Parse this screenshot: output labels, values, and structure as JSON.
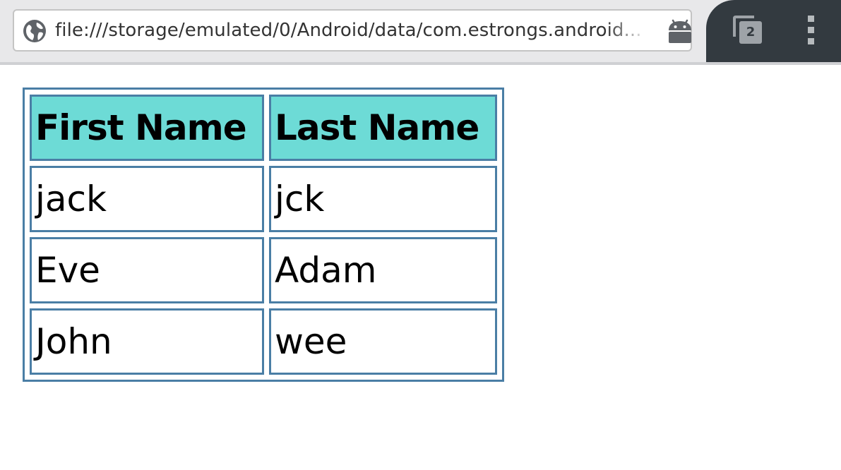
{
  "browser": {
    "url": "file:///storage/emulated/0/Android/data/com.estrongs.android...",
    "tab_count": "2",
    "icons": {
      "site_info": "globe-icon",
      "page_badge": "android-icon",
      "tabs": "tab-switcher-icon",
      "menu": "more-vert-icon"
    }
  },
  "table": {
    "headers": [
      "First Name",
      "Last Name"
    ],
    "rows": [
      [
        "jack",
        "jck"
      ],
      [
        "Eve",
        "Adam"
      ],
      [
        "John",
        "wee"
      ]
    ],
    "colors": {
      "header_bg": "#6ddbd6",
      "border": "#4a7ea5"
    }
  }
}
